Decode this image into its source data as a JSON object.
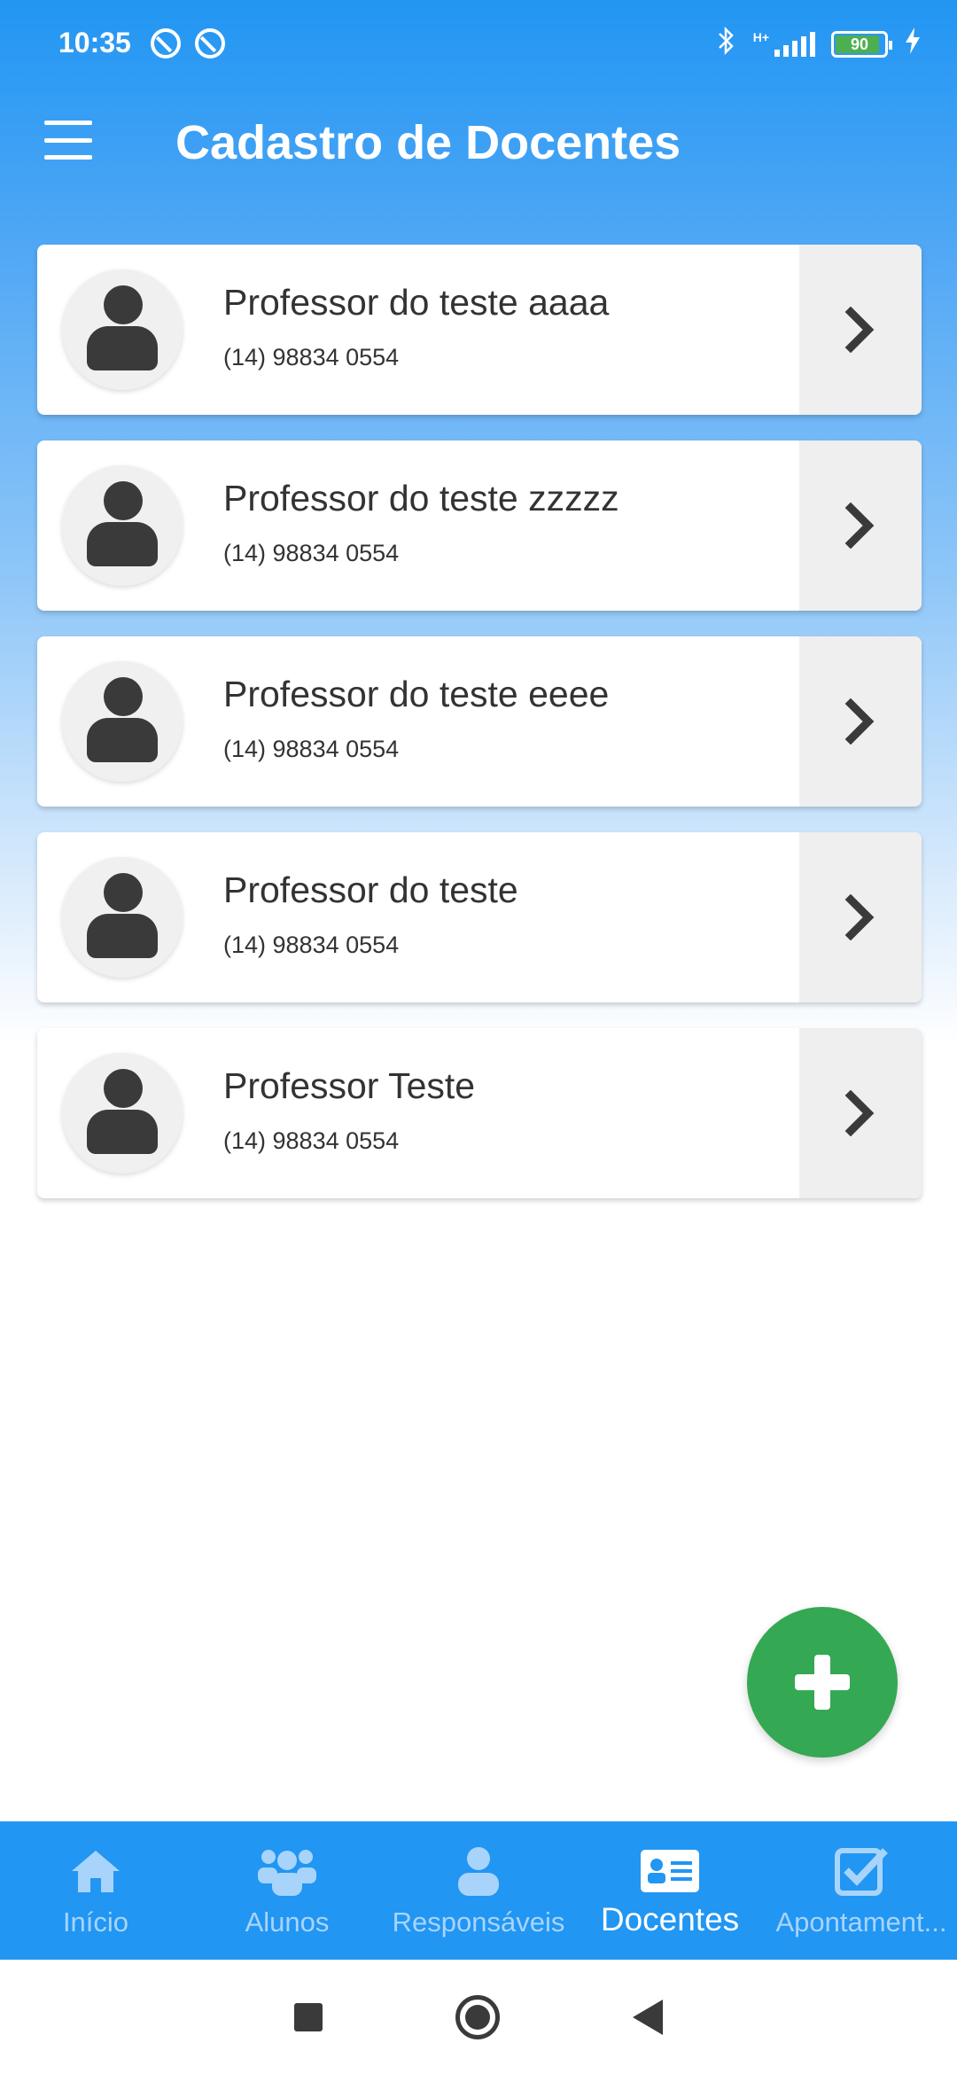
{
  "status_bar": {
    "time": "10:35",
    "network_label": "H+",
    "battery_level": "90",
    "battery_fraction": 0.9
  },
  "app_bar": {
    "title": "Cadastro de Docentes",
    "menu_icon": "hamburger-menu-icon"
  },
  "teachers": [
    {
      "name": "Professor do teste aaaa",
      "phone": "(14) 98834 0554"
    },
    {
      "name": "Professor do teste zzzzz",
      "phone": "(14) 98834 0554"
    },
    {
      "name": "Professor do teste eeee",
      "phone": "(14) 98834 0554"
    },
    {
      "name": "Professor do teste",
      "phone": "(14) 98834 0554"
    },
    {
      "name": "Professor Teste",
      "phone": "(14) 98834 0554"
    }
  ],
  "fab": {
    "icon": "plus-icon",
    "color": "#34a853"
  },
  "bottom_nav": {
    "items": [
      {
        "label": "Início",
        "icon": "home-icon"
      },
      {
        "label": "Alunos",
        "icon": "users-icon"
      },
      {
        "label": "Responsáveis",
        "icon": "user-icon"
      },
      {
        "label": "Docentes",
        "icon": "id-card-icon",
        "active": true
      },
      {
        "label": "Apontament...",
        "icon": "checkbox-icon"
      }
    ]
  },
  "colors": {
    "primary": "#2196f3",
    "nav_inactive": "#a8d4fb",
    "card_text": "#333333",
    "avatar_icon": "#3a3a3a",
    "fab": "#34a853"
  }
}
